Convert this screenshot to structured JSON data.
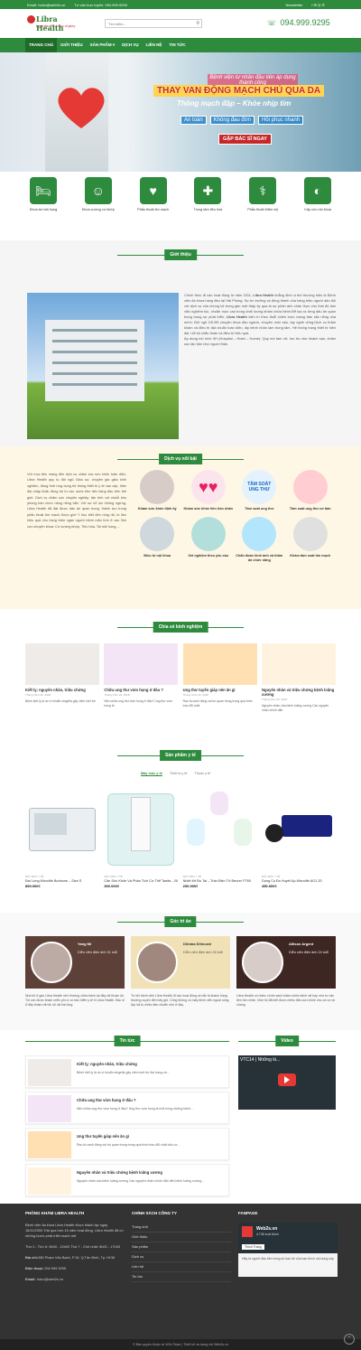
{
  "topbar": {
    "email": "Email: hotro@web2s.vn",
    "advice": "Tư vấn trực tuyến: 094.999.9295",
    "newsletter": "Newsletter"
  },
  "header": {
    "brand": "Libra Health",
    "slogan": "Lead the life - Lotus of glory",
    "search_placeholder": "Tìm kiếm...",
    "hotline": "094.999.9295"
  },
  "nav": [
    "TRANG CHỦ",
    "GIỚI THIỆU",
    "SẢN PHẨM ▾",
    "DỊCH VỤ",
    "LIÊN HỆ",
    "TIN TỨC"
  ],
  "banner": {
    "line1": "Bệnh viện tư nhân đầu tiên áp dụng thành công",
    "line2": "THAY VAN ĐỘNG MẠCH CHỦ QUA DA",
    "line3": "Thông mạch đập – Khỏe nhịp tim",
    "tags": [
      "An toàn",
      "Không đau đớn",
      "Hồi phục nhanh"
    ],
    "cta": "GẶP BÁC SĨ NGAY"
  },
  "services": [
    {
      "label": "Khoa tai mũi họng",
      "icon": "bed-icon"
    },
    {
      "label": "Khoa xương cơ khớp",
      "icon": "head-icon"
    },
    {
      "label": "Phẫu thuật tim mạch",
      "icon": "heart-icon"
    },
    {
      "label": "Trung tâm tiêu hóa",
      "icon": "ambulance-icon"
    },
    {
      "label": "Phẫu thuật thẩm mỹ",
      "icon": "knee-icon"
    },
    {
      "label": "Cấp cứu nội khoa",
      "icon": "stomach-icon"
    }
  ],
  "about": {
    "title": "Giới thiệu",
    "text1": "Chính thức đi vào hoạt động từ năm 2011, ",
    "brand": "Libra Health",
    "text2": " khẳng định vị thế thương hiệu là Bệnh viện đa khoa hàng đầu tại Hải Phòng. Sự tín trưởng và đồng thành của hàng triệu người dân đối với dịch vụ của chúng tôi trong gần một thập kỷ qua là sự phản ánh chân thực cho thái độ làm việc nghiêm túc, chuẩn mực cao trong chất lượng khám chữa bệnh.Để tạo ra từng dấu ấn quan trọng trong sự phát triển, ",
    "brand2": "Libra Health",
    "text3": " kiên trì theo đuổi chiến lược mang bản sắc riêng của mình: Đội ngũ GS.BS chuyên khoa đầu ngành, chuyên môn sâu, tay nghề vững.Dịch vụ thăm khám và điều trị đạt chuẩn toàn diện, lấy bệnh nhân làm trung tâm. Hệ thống trang thiết bị hiện đại, nổi bộ chẩn đoán và điều trị hiệu quả.",
    "text4": "Áp dụng mô hình 3H (Hospital – Hotel – Home): Quy mô tầm cỡ, lưu trú như khách sạn, chăm sóc tận tâm như người thân."
  },
  "featured": {
    "title": "Dịch vụ nổi bật",
    "text": "Với mục tiêu mang đến dịch vụ chăm sóc sức khỏe toàn diện, Libra Health quy tụ đội ngũ Giáo sư, chuyên gia giàu kinh nghiệm, đồng thời ứng dụng hệ thống thiết bị y tế cao cấp, hiện đại nhập khẩu đồng bộ từ các nước tiên tiến hàng đầu trên thế giới. Dịch vụ chăm sóc chuyên nghiệp, tận tình với chuỗi khu phòng bán chức năng riêng biệt. Với sự nỗ lực không ngừng, Libra Health đã đạt được dấu ấn quan trọng, thành tựu trong phẫu thuật tim mạch được giới Y học biết đến rộng rãi, trị liệu hiệu quả cho hàng trăm ngàn người bệnh mãn tính ở các lĩnh vực chuyên khoa: Cơ xương khớp, Tiêu hóa, Tai mũi họng,...",
    "items": [
      "Khám sức khỏe định kỳ",
      "Khám sức khỏe tiền hôn nhân",
      "Tầm soát ung thư",
      "Tầm soát ung thư cơ bản",
      "Điều trị nội khoa",
      "Xét nghiệm theo yêu cầu",
      "Chẩn đoán hình ảnh và thăm dò chức năng",
      "Khám tầm soát tim mạch"
    ],
    "tag_text": "TẦM SOÁT UNG THƯ"
  },
  "experience": {
    "title": "Chia sẻ kinh nghiệm",
    "posts": [
      {
        "title": "Kiết lỵ: nguyên nhân, triệu chứng",
        "date": "Tháng Chín 22, 2018",
        "excerpt": "Bệnh kiết lỵ là do vi khuẩn shigella gây viêm loét bờ"
      },
      {
        "title": "Chữa ung thư vòm họng ở đâu ?",
        "date": "Tháng Chín 22, 2018",
        "excerpt": "Nên chữa ung thư vòm họng ở đâu? Ung thư vòm họng là"
      },
      {
        "title": "Ung thư tuyến giáp nên ăn gì",
        "date": "Tháng Chín 22, 2018",
        "excerpt": "Rau lá xanh đóng vai trò quan trọng trong quá trình trao đổi chất"
      },
      {
        "title": "Nguyên nhân và triệu chứng bệnh loãng xương",
        "date": "Tháng Chín 22, 2018",
        "excerpt": "Nguyên nhân của bệnh loãng xương Các nguyên nhân chính dẫn"
      }
    ]
  },
  "products": {
    "title": "Sản phẩm y tế",
    "tabs": [
      "Máy móc y tế",
      "Thiết bị y tế",
      "Thuốc y tế"
    ],
    "items": [
      {
        "cat": "MÁY MÓC Y TẾ",
        "name": "Đai Lưng Microlife Bonbone – Size S",
        "price": "890.000₫"
      },
      {
        "cat": "MÁY MÓC Y TẾ",
        "name": "Cân Sức Khỏe Và Phân Tích Cơ Thể Tanita – BC-543",
        "price": "300.000₫"
      },
      {
        "cat": "MÁY MÓC Y TẾ",
        "name": "Nhiệt Kế Đo Tai – Trán Điện Tử Beurer FT65",
        "price": "200.000₫"
      },
      {
        "cat": "MÁY MÓC Y TẾ",
        "name": "Dụng Cụ Đo Huyết Áp Microlife AG1-20",
        "price": "450.000₫"
      }
    ]
  },
  "testimonials": {
    "title": "Góc tri ân",
    "items": [
      {
        "name": "Yang Mi",
        "quote": "Diễn viên điện ảnh 31 tuổi",
        "text": "Nhà tôi ở gần Libra Health nên thường chữa bệnh tại đây rất thuận lợi. Tôi còn được khám miễn phí vì có bảo hiểm y tế ở Libra Health. Bác sĩ ở đây khám rất tốt, tôi rất hài lòng."
      },
      {
        "name": "Dilraba Dilmurat",
        "quote": "Diễn viên điện ảnh 26 tuổi",
        "text": "Từ khi bệnh viện Libra Health đi vào hoạt động và vẫn là khách hàng thường xuyên đến bây giờ. Cũng không có mấy bệnh viện ngoài công lập hội tụ nhiều tiêu chuẩn như ở đây."
      },
      {
        "name": "Allison Argent",
        "quote": "Diễn viên điện ảnh 24 tuổi",
        "text": "Libra Health có nhiều chính sách khám chữa bệnh rất hay như tư vấn tiền hôn nhân. Nhờ tôi đã biết được nhiều điều sức khỏe cho cả vợ và chồng."
      }
    ]
  },
  "news": {
    "title": "Tin tức",
    "items": [
      {
        "title": "Kiết lỵ: nguyên nhân, triệu chứng",
        "excerpt": "Bệnh kiết lỵ là do vi khuẩn shigella gây viêm loét bờ đại tràng và..."
      },
      {
        "title": "Chữa ung thư vòm họng ở đâu ?",
        "excerpt": "Nên chữa ung thư vòm họng ở đâu? Ung thư vòm họng là một trong những bệnh..."
      },
      {
        "title": "Ung thư tuyến giáp nên ăn gì",
        "excerpt": "Rau lá xanh đóng vai trò quan trọng trong quá trình trao đổi chất của cơ..."
      },
      {
        "title": "Nguyên nhân và triệu chứng bệnh loãng xương",
        "excerpt": "Nguyên nhân của bệnh loãng xương Các nguyên nhân chính dẫn đến bệnh loãng xương..."
      }
    ]
  },
  "video": {
    "title": "Video",
    "caption": "VTC14 | Những ki..."
  },
  "footer": {
    "col1_title": "PHÒNG KHÁM LIBRA HEALTH",
    "col1_text": "Bệnh viện đa khoa Libra Health được thành lập ngày 16/11/2000.Trải qua hơn 15 năm hoạt động, Libra Health đã có những bước phát triển mạnh mẽ.",
    "hours": "Thứ 2 - Thứ 6: 8h00 - 22h00 Thứ 7 - Chủ nhật: 8h00 - 17h30",
    "address_label": "Địa chỉ:",
    "address": "285 Phạm Văn Bạch, P.15, Q.Tân Bình, Tp. HCM",
    "phone_label": "Điện thoại:",
    "phone": "094 999 9295",
    "email_label": "Email:",
    "email": "hotro@web2s.vn",
    "col2_title": "CHÍNH SÁCH CÔNG TY",
    "links": [
      "Trang chủ",
      "Giới thiệu",
      "Sản phẩm",
      "Dịch vụ",
      "Liên hệ",
      "Tin tức"
    ],
    "col3_title": "FANPAGE",
    "fanpage_name": "Web2s.vn",
    "fanpage_likes": "4.736 lượt thích",
    "fanpage_text": "Hãy là người đầu tiên trong số bạn bè của bạn thích nội dung này",
    "like_btn": "Thích Trang"
  },
  "copyright": "© Bản quyền thuộc về W2s Team | Thiết kế và dựng với Web2s.vn"
}
